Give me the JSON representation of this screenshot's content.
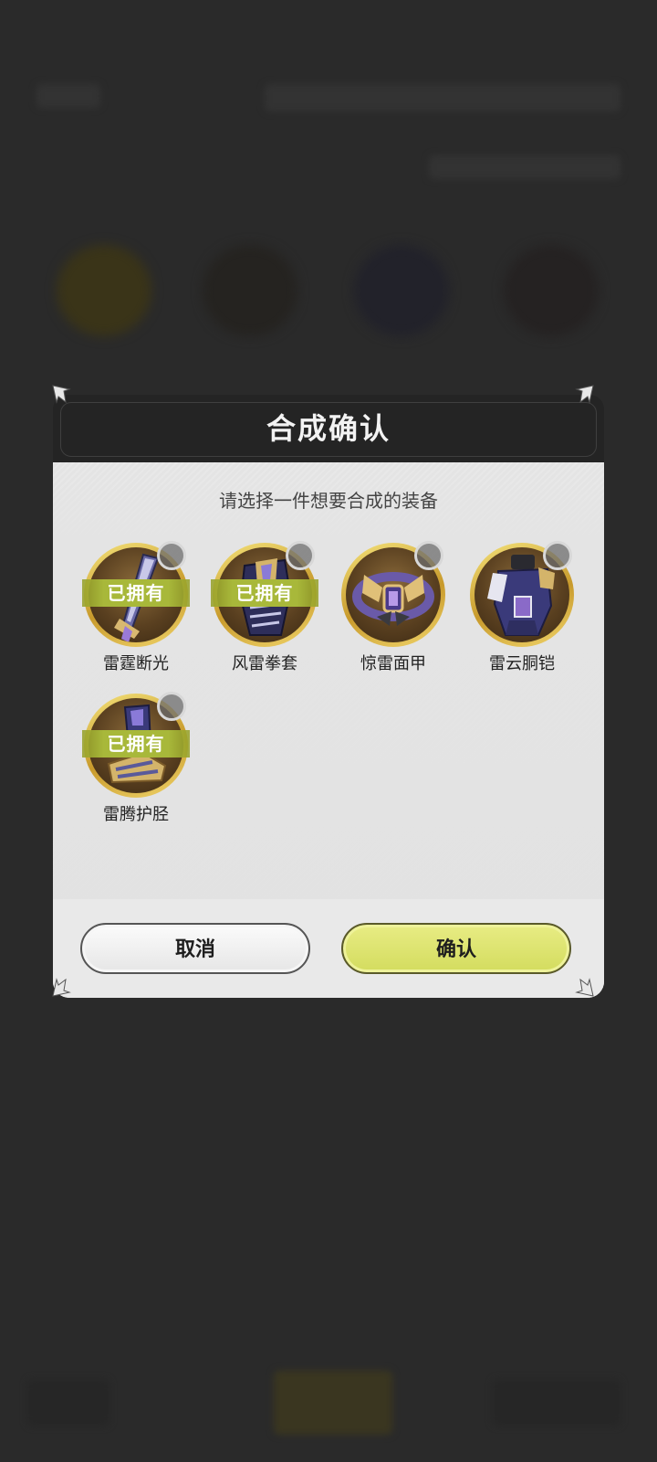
{
  "dialog": {
    "title": "合成确认",
    "subtitle": "请选择一件想要合成的装备",
    "items": [
      {
        "name": "雷霆断光",
        "owned_label": "已拥有",
        "owned": true,
        "icon": "sword-icon",
        "selected": false
      },
      {
        "name": "风雷拳套",
        "owned_label": "已拥有",
        "owned": true,
        "icon": "gauntlet-icon",
        "selected": false
      },
      {
        "name": "惊雷面甲",
        "owned_label": "",
        "owned": false,
        "icon": "mask-icon",
        "selected": false
      },
      {
        "name": "雷云胴铠",
        "owned_label": "",
        "owned": false,
        "icon": "armor-icon",
        "selected": false
      },
      {
        "name": "雷腾护胫",
        "owned_label": "已拥有",
        "owned": true,
        "icon": "boots-icon",
        "selected": false
      }
    ],
    "buttons": {
      "cancel": "取消",
      "confirm": "确认"
    }
  },
  "colors": {
    "overlay": "#2a2a2a",
    "header": "#242424",
    "body": "#e4e4e4",
    "owned_badge": "#a8b83a",
    "confirm_button": "#d6de62",
    "frame_gold": "#e0b84a"
  }
}
